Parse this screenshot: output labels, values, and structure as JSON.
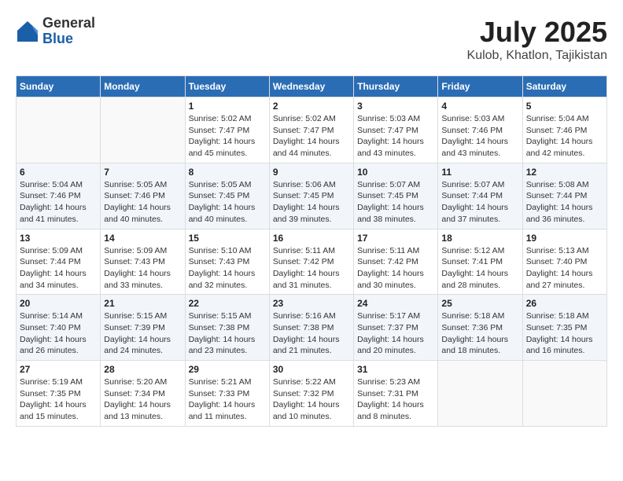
{
  "header": {
    "logo_general": "General",
    "logo_blue": "Blue",
    "month": "July 2025",
    "location": "Kulob, Khatlon, Tajikistan"
  },
  "weekdays": [
    "Sunday",
    "Monday",
    "Tuesday",
    "Wednesday",
    "Thursday",
    "Friday",
    "Saturday"
  ],
  "weeks": [
    [
      {
        "day": "",
        "info": ""
      },
      {
        "day": "",
        "info": ""
      },
      {
        "day": "1",
        "info": "Sunrise: 5:02 AM\nSunset: 7:47 PM\nDaylight: 14 hours and 45 minutes."
      },
      {
        "day": "2",
        "info": "Sunrise: 5:02 AM\nSunset: 7:47 PM\nDaylight: 14 hours and 44 minutes."
      },
      {
        "day": "3",
        "info": "Sunrise: 5:03 AM\nSunset: 7:47 PM\nDaylight: 14 hours and 43 minutes."
      },
      {
        "day": "4",
        "info": "Sunrise: 5:03 AM\nSunset: 7:46 PM\nDaylight: 14 hours and 43 minutes."
      },
      {
        "day": "5",
        "info": "Sunrise: 5:04 AM\nSunset: 7:46 PM\nDaylight: 14 hours and 42 minutes."
      }
    ],
    [
      {
        "day": "6",
        "info": "Sunrise: 5:04 AM\nSunset: 7:46 PM\nDaylight: 14 hours and 41 minutes."
      },
      {
        "day": "7",
        "info": "Sunrise: 5:05 AM\nSunset: 7:46 PM\nDaylight: 14 hours and 40 minutes."
      },
      {
        "day": "8",
        "info": "Sunrise: 5:05 AM\nSunset: 7:45 PM\nDaylight: 14 hours and 40 minutes."
      },
      {
        "day": "9",
        "info": "Sunrise: 5:06 AM\nSunset: 7:45 PM\nDaylight: 14 hours and 39 minutes."
      },
      {
        "day": "10",
        "info": "Sunrise: 5:07 AM\nSunset: 7:45 PM\nDaylight: 14 hours and 38 minutes."
      },
      {
        "day": "11",
        "info": "Sunrise: 5:07 AM\nSunset: 7:44 PM\nDaylight: 14 hours and 37 minutes."
      },
      {
        "day": "12",
        "info": "Sunrise: 5:08 AM\nSunset: 7:44 PM\nDaylight: 14 hours and 36 minutes."
      }
    ],
    [
      {
        "day": "13",
        "info": "Sunrise: 5:09 AM\nSunset: 7:44 PM\nDaylight: 14 hours and 34 minutes."
      },
      {
        "day": "14",
        "info": "Sunrise: 5:09 AM\nSunset: 7:43 PM\nDaylight: 14 hours and 33 minutes."
      },
      {
        "day": "15",
        "info": "Sunrise: 5:10 AM\nSunset: 7:43 PM\nDaylight: 14 hours and 32 minutes."
      },
      {
        "day": "16",
        "info": "Sunrise: 5:11 AM\nSunset: 7:42 PM\nDaylight: 14 hours and 31 minutes."
      },
      {
        "day": "17",
        "info": "Sunrise: 5:11 AM\nSunset: 7:42 PM\nDaylight: 14 hours and 30 minutes."
      },
      {
        "day": "18",
        "info": "Sunrise: 5:12 AM\nSunset: 7:41 PM\nDaylight: 14 hours and 28 minutes."
      },
      {
        "day": "19",
        "info": "Sunrise: 5:13 AM\nSunset: 7:40 PM\nDaylight: 14 hours and 27 minutes."
      }
    ],
    [
      {
        "day": "20",
        "info": "Sunrise: 5:14 AM\nSunset: 7:40 PM\nDaylight: 14 hours and 26 minutes."
      },
      {
        "day": "21",
        "info": "Sunrise: 5:15 AM\nSunset: 7:39 PM\nDaylight: 14 hours and 24 minutes."
      },
      {
        "day": "22",
        "info": "Sunrise: 5:15 AM\nSunset: 7:38 PM\nDaylight: 14 hours and 23 minutes."
      },
      {
        "day": "23",
        "info": "Sunrise: 5:16 AM\nSunset: 7:38 PM\nDaylight: 14 hours and 21 minutes."
      },
      {
        "day": "24",
        "info": "Sunrise: 5:17 AM\nSunset: 7:37 PM\nDaylight: 14 hours and 20 minutes."
      },
      {
        "day": "25",
        "info": "Sunrise: 5:18 AM\nSunset: 7:36 PM\nDaylight: 14 hours and 18 minutes."
      },
      {
        "day": "26",
        "info": "Sunrise: 5:18 AM\nSunset: 7:35 PM\nDaylight: 14 hours and 16 minutes."
      }
    ],
    [
      {
        "day": "27",
        "info": "Sunrise: 5:19 AM\nSunset: 7:35 PM\nDaylight: 14 hours and 15 minutes."
      },
      {
        "day": "28",
        "info": "Sunrise: 5:20 AM\nSunset: 7:34 PM\nDaylight: 14 hours and 13 minutes."
      },
      {
        "day": "29",
        "info": "Sunrise: 5:21 AM\nSunset: 7:33 PM\nDaylight: 14 hours and 11 minutes."
      },
      {
        "day": "30",
        "info": "Sunrise: 5:22 AM\nSunset: 7:32 PM\nDaylight: 14 hours and 10 minutes."
      },
      {
        "day": "31",
        "info": "Sunrise: 5:23 AM\nSunset: 7:31 PM\nDaylight: 14 hours and 8 minutes."
      },
      {
        "day": "",
        "info": ""
      },
      {
        "day": "",
        "info": ""
      }
    ]
  ]
}
